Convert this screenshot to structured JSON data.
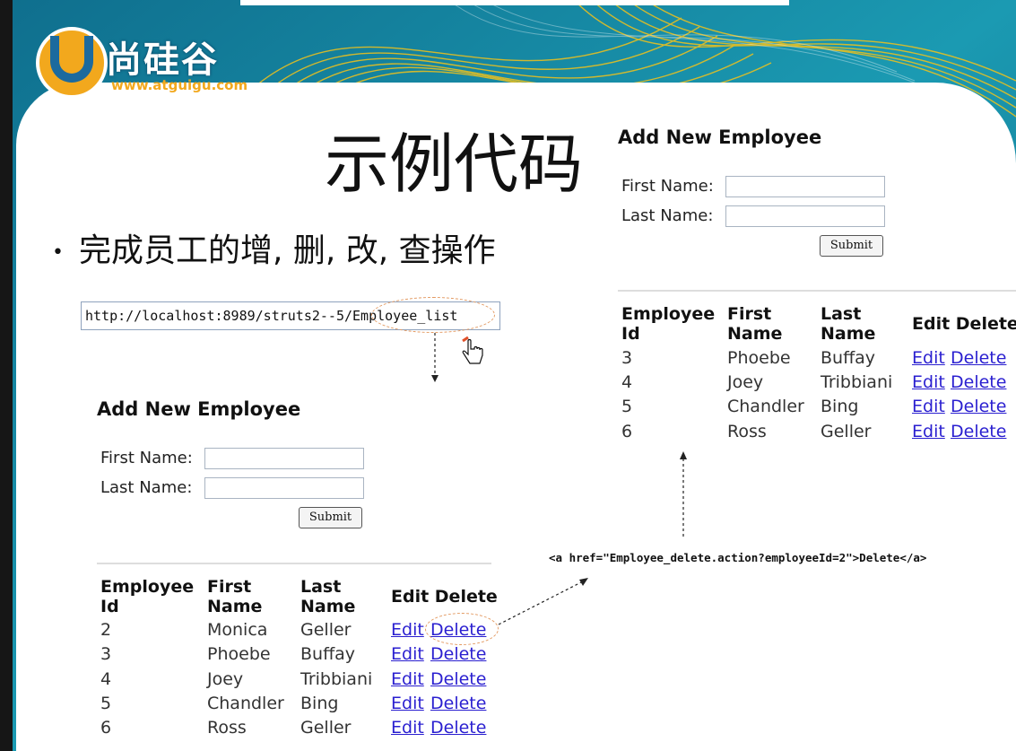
{
  "logo": {
    "name": "尚硅谷",
    "url": "www.atguigu.com"
  },
  "slide": {
    "title": "示例代码",
    "bullet": "完成员工的增, 删, 改, 查操作",
    "url": "http://localhost:8989/struts2--5/Employee_list",
    "code": "<a href=\"Employee_delete.action?employeeId=2\">Delete</a>"
  },
  "form": {
    "heading": "Add New Employee",
    "first_name_label": "First Name:",
    "last_name_label": "Last Name:",
    "submit_label": "Submit"
  },
  "table": {
    "headers": {
      "id_line1": "Employee",
      "id_line2": "Id",
      "first_line1": "First",
      "first_line2": "Name",
      "last_line1": "Last",
      "last_line2": "Name",
      "actions": "Edit Delete"
    },
    "edit_label": "Edit",
    "delete_label": "Delete",
    "left_rows": [
      {
        "id": "2",
        "first": "Monica",
        "last": "Geller"
      },
      {
        "id": "3",
        "first": "Phoebe",
        "last": "Buffay"
      },
      {
        "id": "4",
        "first": "Joey",
        "last": "Tribbiani"
      },
      {
        "id": "5",
        "first": "Chandler",
        "last": "Bing"
      },
      {
        "id": "6",
        "first": "Ross",
        "last": "Geller"
      }
    ],
    "right_rows": [
      {
        "id": "3",
        "first": "Phoebe",
        "last": "Buffay"
      },
      {
        "id": "4",
        "first": "Joey",
        "last": "Tribbiani"
      },
      {
        "id": "5",
        "first": "Chandler",
        "last": "Bing"
      },
      {
        "id": "6",
        "first": "Ross",
        "last": "Geller"
      }
    ]
  },
  "colors": {
    "teal": "#1b8aa4",
    "gold": "#f2c21a",
    "link": "#2a1fd0",
    "annotation": "#e39a62"
  }
}
